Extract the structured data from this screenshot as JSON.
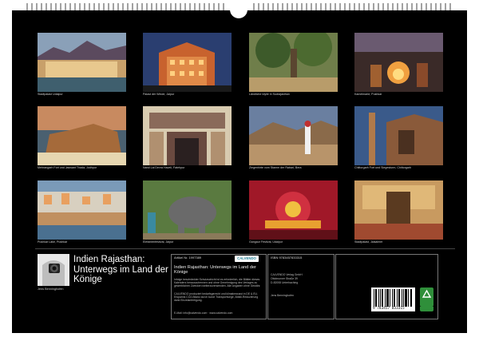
{
  "captions": [
    "Stadtpalast Udaipur",
    "Palast der Winde, Jaipur",
    "Ländliche Idylle in Sudrajasthan",
    "Kamelmarkt, Pushkar",
    "Mehrangarh Fort und Jaswant Thada, Jodhpur",
    "Nand Lal Devra Haveli, Fatehpur",
    "Ziegenhirte vom Stamm der Rabari, Bera",
    "Chittorgarh Fort und Siegesturm, Chittorgarh",
    "Pushkar Lake, Pushkar",
    "Elefantenfestival, Jaipur",
    "Gangaur Festival, Udaipur",
    "Stadtpalast, Jaisalmer"
  ],
  "author": "Jens Benninghofen",
  "title": "Indien Rajasthan: Unterwegs im Land der Könige",
  "info": {
    "artikel_label": "Artikel Nr. 1997389",
    "logo_text": "CALVENDO",
    "small_title": "Indien Rajasthan: Unterwegs im Land der Könige",
    "desc1": "Infolge beschränkter Schutzschicht ist es erforderlich, die Blätter dieses Kalenders herauszutrennen und ohne Genehmigung des Verlages zu gewerblichen Zwecken weiterzuverwenden. Alle Angaben ohne Gewähr.",
    "desc2": "CALVENDO produziert bedarfsgerecht und klimabewusst in DE & EU. Ersparnis CO2-Bilanz durch kurze Transportwege, Abfall-Reduzierung dank Einzelanfertigung.",
    "contact": "E-Mail: info@calvendo.com · www.calvendo.com",
    "isbn": "ISBN 9783457833315",
    "publisher_lines": [
      "CALVENDO Verlag GmbH",
      "Ottobrunner Straße 39",
      "D-82008 Unterhaching"
    ],
    "author_line": "Jens Benninghofen",
    "barcode_text": "9 783457 833315"
  },
  "colors": {
    "background": "#000000",
    "page": "#ffffff",
    "text": "#ffffff",
    "caption": "#cfcfcf"
  },
  "icons": [
    "binding-wire",
    "camera-portrait-icon",
    "calvendo-logo-icon",
    "barcode-icon",
    "recycle-icon"
  ]
}
